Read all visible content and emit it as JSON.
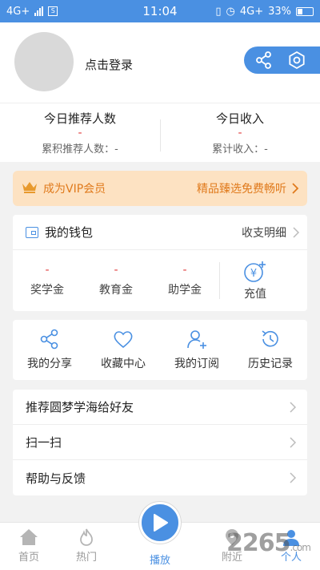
{
  "status_bar": {
    "left_net": "4G+",
    "time": "11:04",
    "right_net": "4G+",
    "battery": "33%"
  },
  "profile": {
    "login_label": "点击登录"
  },
  "stats": {
    "referrals_today_label": "今日推荐人数",
    "referrals_today_value": "-",
    "referrals_total": "累积推荐人数：-",
    "income_today_label": "今日收入",
    "income_today_value": "-",
    "income_total": "累计收入：-"
  },
  "vip": {
    "label": "成为VIP会员",
    "promo": "精品臻选免费畅听"
  },
  "wallet": {
    "title": "我的钱包",
    "details_label": "收支明细",
    "items": [
      {
        "label": "奖学金",
        "value": "-"
      },
      {
        "label": "教育金",
        "value": "-"
      },
      {
        "label": "助学金",
        "value": "-"
      }
    ],
    "recharge_label": "充值"
  },
  "actions": [
    {
      "label": "我的分享",
      "icon": "share-icon"
    },
    {
      "label": "收藏中心",
      "icon": "heart-icon"
    },
    {
      "label": "我的订阅",
      "icon": "user-add-icon"
    },
    {
      "label": "历史记录",
      "icon": "history-icon"
    }
  ],
  "menu": [
    {
      "label": "推荐圆梦学海给好友"
    },
    {
      "label": "扫一扫"
    },
    {
      "label": "帮助与反馈"
    }
  ],
  "tabs": [
    {
      "label": "首页"
    },
    {
      "label": "热门"
    },
    {
      "label": "播放"
    },
    {
      "label": "附近"
    },
    {
      "label": "个人"
    }
  ],
  "colors": {
    "primary": "#4a90e2",
    "accent_red": "#e03c3c",
    "vip_text": "#e07a1c",
    "vip_bg": "#fde2c2"
  },
  "watermark": {
    "text": "2265",
    "suffix": ".com"
  }
}
